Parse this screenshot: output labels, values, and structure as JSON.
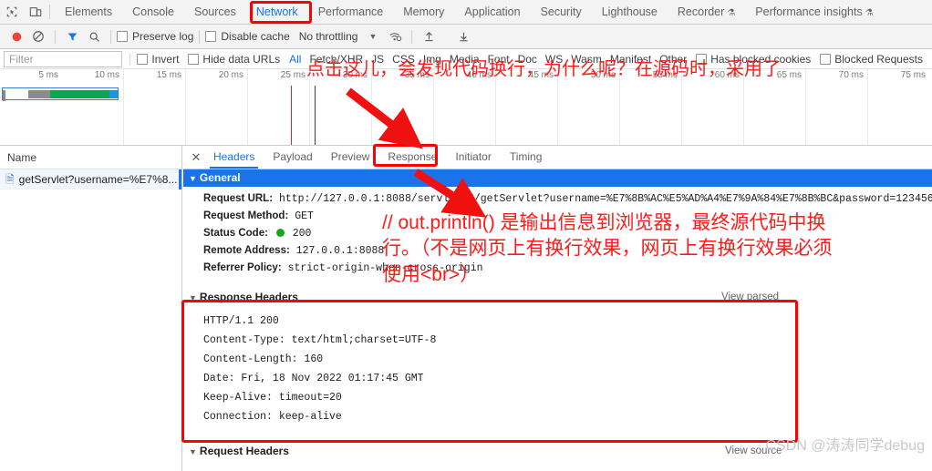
{
  "devtools": {
    "panel_tabs": [
      {
        "label": "Elements",
        "selected": false,
        "flask": false
      },
      {
        "label": "Console",
        "selected": false,
        "flask": false
      },
      {
        "label": "Sources",
        "selected": false,
        "flask": false
      },
      {
        "label": "Network",
        "selected": true,
        "flask": false
      },
      {
        "label": "Performance",
        "selected": false,
        "flask": false
      },
      {
        "label": "Memory",
        "selected": false,
        "flask": false
      },
      {
        "label": "Application",
        "selected": false,
        "flask": false
      },
      {
        "label": "Security",
        "selected": false,
        "flask": false
      },
      {
        "label": "Lighthouse",
        "selected": false,
        "flask": false
      },
      {
        "label": "Recorder",
        "selected": false,
        "flask": true
      },
      {
        "label": "Performance insights",
        "selected": false,
        "flask": true
      }
    ],
    "toolbar": {
      "record_title": "record",
      "clear_title": "clear",
      "filter_title": "filter",
      "search_title": "search",
      "preserve_log_label": "Preserve log",
      "disable_cache_label": "Disable cache",
      "throttling_label": "No throttling",
      "import_title": "import-har",
      "export_title": "export-har"
    },
    "filterbar": {
      "filter_placeholder": "Filter",
      "invert_label": "Invert",
      "hide_data_urls_label": "Hide data URLs",
      "types": [
        "All",
        "Fetch/XHR",
        "JS",
        "CSS",
        "Img",
        "Media",
        "Font",
        "Doc",
        "WS",
        "Wasm",
        "Manifest",
        "Other"
      ],
      "selected_type": "All",
      "has_blocked_cookies_label": "Has blocked cookies",
      "blocked_requests_label": "Blocked Requests"
    },
    "timeline": {
      "ticks": [
        "5 ms",
        "10 ms",
        "15 ms",
        "20 ms",
        "25 ms",
        "30 ms",
        "35 ms",
        "40 ms",
        "45 ms",
        "50 ms",
        "55 ms",
        "60 ms",
        "65 ms",
        "70 ms",
        "75 ms"
      ]
    },
    "request_list": {
      "column_header": "Name",
      "rows": [
        {
          "name": "getServlet?username=%E7%8...",
          "selected": true
        }
      ]
    },
    "detail": {
      "tabs": [
        {
          "label": "Headers",
          "selected": true
        },
        {
          "label": "Payload",
          "selected": false
        },
        {
          "label": "Preview",
          "selected": false
        },
        {
          "label": "Response",
          "selected": false
        },
        {
          "label": "Initiator",
          "selected": false
        },
        {
          "label": "Timing",
          "selected": false
        }
      ],
      "general": {
        "title": "General",
        "items": [
          {
            "key": "Request URL:",
            "value": "http://127.0.0.1:8088/servlet05/getServlet?username=%E7%8B%AC%E5%AD%A4%E7%9A%84%E7%8B%BC&password=123456"
          },
          {
            "key": "Request Method:",
            "value": "GET"
          },
          {
            "key": "Status Code:",
            "value": "200",
            "status_dot": "#14a818"
          },
          {
            "key": "Remote Address:",
            "value": "127.0.0.1:8088"
          },
          {
            "key": "Referrer Policy:",
            "value": "strict-origin-when-cross-origin"
          }
        ]
      },
      "response_headers": {
        "title": "Response Headers",
        "view_link": "View parsed",
        "lines": [
          "HTTP/1.1 200",
          "Content-Type: text/html;charset=UTF-8",
          "Content-Length: 160",
          "Date: Fri, 18 Nov 2022 01:17:45 GMT",
          "Keep-Alive: timeout=20",
          "Connection: keep-alive"
        ]
      },
      "request_headers": {
        "title": "Request Headers",
        "view_link": "View source"
      }
    }
  },
  "annotations": {
    "top_note": "点击这儿，会发现代码换行，为什么呢？在源码时，采用了",
    "mid_note_line1": "// out.println() 是输出信息到浏览器，最终源代码中换",
    "mid_note_line2": "行。（不是网页上有换行效果，网页上有换行效果必须",
    "mid_note_line3": "使用<br>）",
    "accent_color": "#ff0000",
    "watermark": "CSDN @涛涛同学debug"
  }
}
